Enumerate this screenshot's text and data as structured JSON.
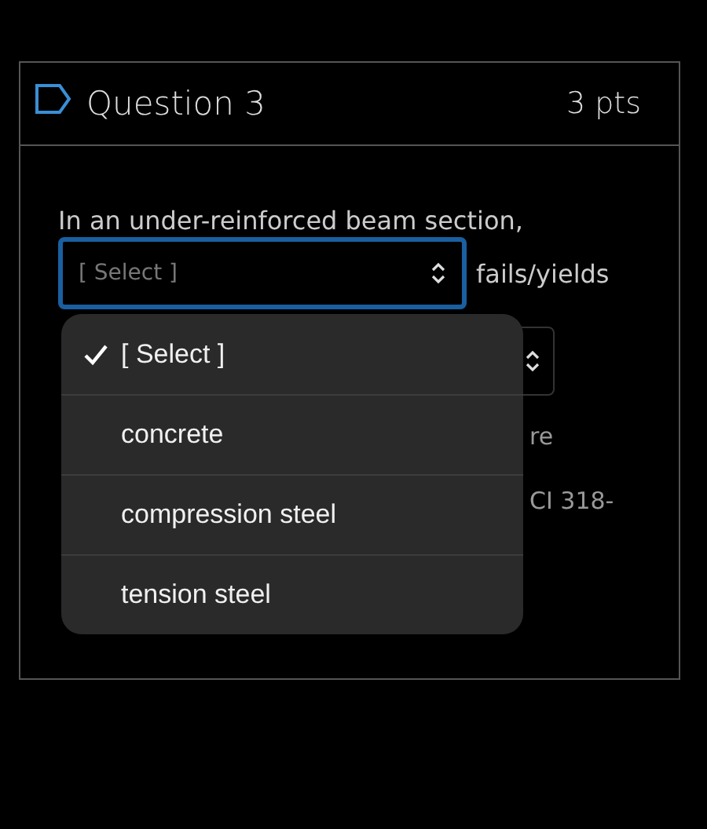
{
  "question": {
    "title": "Question 3",
    "points": "3 pts"
  },
  "body": {
    "text": "In an under-reinforced beam section,",
    "select": {
      "placeholder": "[ Select ]",
      "focused": true
    },
    "after_select": "fails/yields",
    "partial_line_1": "re",
    "partial_line_2": "CI 318-"
  },
  "dropdown": {
    "options": [
      {
        "label": "[ Select ]",
        "selected": true
      },
      {
        "label": "concrete",
        "selected": false
      },
      {
        "label": "compression steel",
        "selected": false
      },
      {
        "label": "tension steel",
        "selected": false
      }
    ]
  }
}
